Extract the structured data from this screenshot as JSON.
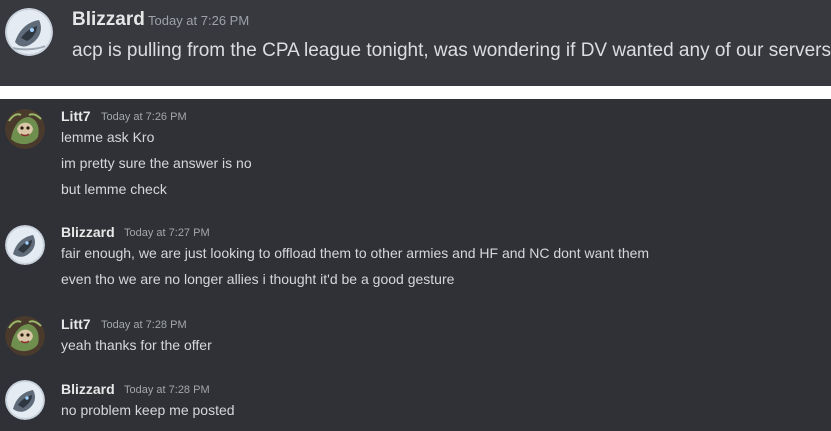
{
  "top": {
    "author": "Blizzard",
    "time": "Today at 7:26 PM",
    "text": "acp is pulling from the CPA league tonight, was wondering if DV wanted any of our servers"
  },
  "messages": [
    {
      "author": "Litt7",
      "time": "Today at 7:26 PM",
      "avatar": "litt7-avatar",
      "lines": [
        "lemme ask Kro",
        "im pretty sure the answer is no",
        "but lemme check"
      ]
    },
    {
      "author": "Blizzard",
      "time": "Today at 7:27 PM",
      "avatar": "blizzard-avatar",
      "lines": [
        "fair enough, we are just looking to offload them to other armies and HF and NC dont want them",
        "even tho we are no longer allies i thought it'd be a good gesture"
      ]
    },
    {
      "author": "Litt7",
      "time": "Today at 7:28 PM",
      "avatar": "litt7-avatar",
      "lines": [
        "yeah thanks for the offer"
      ]
    },
    {
      "author": "Blizzard",
      "time": "Today at 7:28 PM",
      "avatar": "blizzard-avatar",
      "lines": [
        "no problem keep me posted"
      ]
    }
  ],
  "colors": {
    "top_background": "#37393f",
    "chat_background": "#2f3136",
    "author_text": "#e8e8e8",
    "message_text": "#d6d7da",
    "timestamp_text": "#a3a6aa"
  }
}
